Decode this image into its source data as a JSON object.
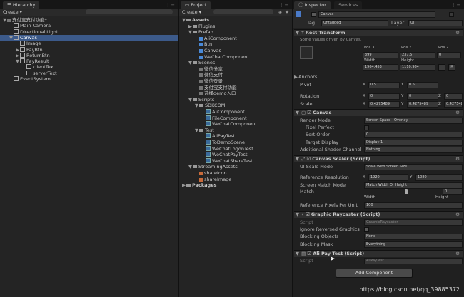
{
  "hierarchy": {
    "tab_label": "Hierarchy",
    "create_label": "Create ▾",
    "items": [
      {
        "label": "支付宝支付功能*",
        "arrow": "▼",
        "depth": 0
      },
      {
        "label": "Main Camera",
        "arrow": "",
        "depth": 1
      },
      {
        "label": "Directional Light",
        "arrow": "",
        "depth": 1
      },
      {
        "label": "Canvas",
        "arrow": "▼",
        "depth": 1
      },
      {
        "label": "Image",
        "arrow": "",
        "depth": 2
      },
      {
        "label": "PayBtn",
        "arrow": "▶",
        "depth": 2
      },
      {
        "label": "ReturnBtn",
        "arrow": "▶",
        "depth": 2
      },
      {
        "label": "PayResult",
        "arrow": "▼",
        "depth": 2
      },
      {
        "label": "clientText",
        "arrow": "",
        "depth": 3
      },
      {
        "label": "serverText",
        "arrow": "",
        "depth": 3
      },
      {
        "label": "EventSystem",
        "arrow": "",
        "depth": 1
      }
    ]
  },
  "project": {
    "tab_label": "Project",
    "create_label": "Create ▾",
    "items": [
      {
        "label": "Assets",
        "arrow": "▼",
        "depth": 0,
        "icon": "folder",
        "bold": true
      },
      {
        "label": "Plugins",
        "arrow": "▶",
        "depth": 1,
        "icon": "folder"
      },
      {
        "label": "Prefab",
        "arrow": "▼",
        "depth": 1,
        "icon": "folder"
      },
      {
        "label": "AliComponent",
        "arrow": "",
        "depth": 2,
        "icon": "prefab"
      },
      {
        "label": "Btn",
        "arrow": "",
        "depth": 2,
        "icon": "prefab"
      },
      {
        "label": "Canvas",
        "arrow": "",
        "depth": 2,
        "icon": "prefab"
      },
      {
        "label": "WeChatComponent",
        "arrow": "",
        "depth": 2,
        "icon": "prefab"
      },
      {
        "label": "Scenes",
        "arrow": "▼",
        "depth": 1,
        "icon": "folder"
      },
      {
        "label": "微信分享",
        "arrow": "",
        "depth": 2,
        "icon": "unity"
      },
      {
        "label": "微信支付",
        "arrow": "",
        "depth": 2,
        "icon": "unity"
      },
      {
        "label": "微信登录",
        "arrow": "",
        "depth": 2,
        "icon": "unity"
      },
      {
        "label": "支付宝支付功能",
        "arrow": "",
        "depth": 2,
        "icon": "unity"
      },
      {
        "label": "选择demo入口",
        "arrow": "",
        "depth": 2,
        "icon": "unity"
      },
      {
        "label": "Scripts",
        "arrow": "▼",
        "depth": 1,
        "icon": "folder"
      },
      {
        "label": "SDKCOM",
        "arrow": "▼",
        "depth": 2,
        "icon": "folder"
      },
      {
        "label": "AliComponent",
        "arrow": "",
        "depth": 3,
        "icon": "file"
      },
      {
        "label": "FileComponent",
        "arrow": "",
        "depth": 3,
        "icon": "file"
      },
      {
        "label": "WeChatComponent",
        "arrow": "",
        "depth": 3,
        "icon": "file"
      },
      {
        "label": "Test",
        "arrow": "▼",
        "depth": 2,
        "icon": "folder"
      },
      {
        "label": "AliPayTest",
        "arrow": "",
        "depth": 3,
        "icon": "file"
      },
      {
        "label": "ToDemoScene",
        "arrow": "",
        "depth": 3,
        "icon": "file"
      },
      {
        "label": "WeChatLogonTest",
        "arrow": "",
        "depth": 3,
        "icon": "file"
      },
      {
        "label": "WeChatPayTest",
        "arrow": "",
        "depth": 3,
        "icon": "file"
      },
      {
        "label": "WeChatShareTest",
        "arrow": "",
        "depth": 3,
        "icon": "file"
      },
      {
        "label": "StreamingAssets",
        "arrow": "▼",
        "depth": 1,
        "icon": "folder"
      },
      {
        "label": "shareIcon",
        "arrow": "",
        "depth": 2,
        "icon": "image"
      },
      {
        "label": "shareImage",
        "arrow": "",
        "depth": 2,
        "icon": "image"
      },
      {
        "label": "Packages",
        "arrow": "▶",
        "depth": 0,
        "icon": "folder",
        "bold": true
      }
    ]
  },
  "inspector": {
    "tab_label": "Inspector",
    "tab2_label": "Services",
    "object_name": "Canvas",
    "tag_label": "Tag",
    "tag_value": "Untagged",
    "layer_label": "Layer",
    "layer_value": "UI",
    "rect_transform": {
      "title": "Rect Transform",
      "note": "Some values driven by Canvas.",
      "posx_label": "Pos X",
      "posy_label": "Pos Y",
      "posz_label": "Pos Z",
      "posx": "399",
      "posy": "237.5",
      "posz": "0",
      "width_label": "Width",
      "height_label": "Height",
      "width": "1964.453",
      "height": "1110.984",
      "anchors_label": "Anchors",
      "pivot_label": "Pivot",
      "pivot_x": "0.5",
      "pivot_y": "0.5",
      "rotation_label": "Rotation",
      "rot_x": "0",
      "rot_y": "0",
      "rot_z": "0",
      "scale_label": "Scale",
      "scale_x": "0.4275489",
      "scale_y": "0.4275489",
      "scale_z": "0.4275489"
    },
    "canvas": {
      "title": "Canvas",
      "render_mode_label": "Render Mode",
      "render_mode": "Screen Space - Overlay",
      "pixel_perfect_label": "Pixel Perfect",
      "sort_order_label": "Sort Order",
      "sort_order": "0",
      "target_display_label": "Target Display",
      "target_display": "Display 1",
      "shader_label": "Additional Shader Channel",
      "shader": "Nothing"
    },
    "canvas_scaler": {
      "title": "Canvas Scaler (Script)",
      "ui_scale_label": "UI Scale Mode",
      "ui_scale": "Scale With Screen Size",
      "ref_res_label": "Reference Resolution",
      "ref_x": "1920",
      "ref_y": "1080",
      "match_mode_label": "Screen Match Mode",
      "match_mode": "Match Width Or Height",
      "match_label": "Match",
      "match_value": "0",
      "width_caption": "Width",
      "height_caption": "Height",
      "ppu_label": "Reference Pixels Per Unit",
      "ppu": "100"
    },
    "graphic_raycaster": {
      "title": "Graphic Raycaster (Script)",
      "script_label": "Script",
      "script": "GraphicRaycaster",
      "ignore_label": "Ignore Reversed Graphics",
      "blocking_objects_label": "Blocking Objects",
      "blocking_objects": "None",
      "blocking_mask_label": "Blocking Mask",
      "blocking_mask": "Everything"
    },
    "ali_pay_test": {
      "title": "Ali Pay Test (Script)",
      "script_label": "Script",
      "script": "AliPayTest"
    },
    "add_component_label": "Add Component"
  },
  "watermark": "https://blog.csdn.net/qq_39885372"
}
